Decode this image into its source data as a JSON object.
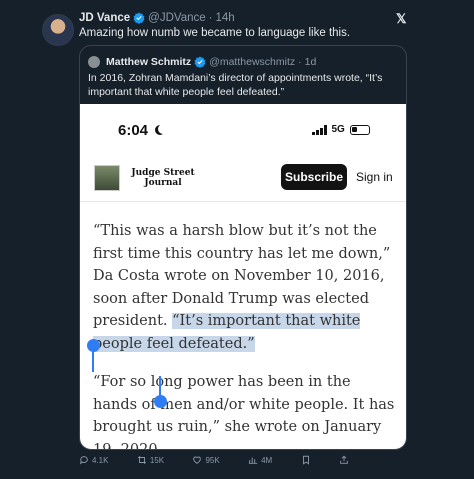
{
  "tweet": {
    "author_name": "JD Vance",
    "author_handle": "@JDVance",
    "time": "14h",
    "text": "Amazing how numb we became to language like this."
  },
  "quote": {
    "author_name": "Matthew Schmitz",
    "author_handle": "@matthewschmitz",
    "time": "1d",
    "text": "In 2016, Zohran Mamdani’s director of appointments wrote, “It’s important that white people feel defeated.”"
  },
  "phone": {
    "time": "6:04",
    "network": "5G"
  },
  "site": {
    "name_line1": "Judge Street",
    "name_line2": "Journal",
    "subscribe_label": "Subscribe",
    "signin_label": "Sign in"
  },
  "article": {
    "para1_pre": "“This was a harsh blow but it’s not the first time this country has let me down,” Da Costa wrote on November 10, 2016, soon after Donald Trump was elected president. ",
    "para1_highlight": "“It’s important that white people feel defeated.”",
    "para2": "“For so long power has been in the hands of men and/or white people. It has brought us ruin,” she wrote on January 19, 2020."
  },
  "actions": {
    "replies": "4.1K",
    "reposts": "15K",
    "likes": "95K",
    "views": "4M"
  },
  "colors": {
    "background": "#15202b",
    "selection": "#c7d7e9",
    "selection_handle": "#2e7df5",
    "verified": "#1d9bf0"
  }
}
